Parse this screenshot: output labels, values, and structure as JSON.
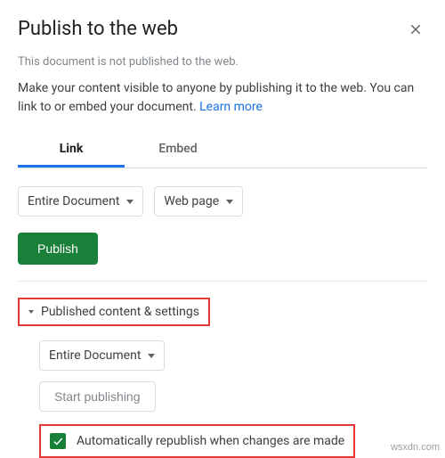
{
  "header": {
    "title": "Publish to the web",
    "subtitle": "This document is not published to the web.",
    "description_prefix": "Make your content visible to anyone by publishing it to the web. You can link to or embed your document. ",
    "learn_more": "Learn more"
  },
  "tabs": {
    "link": "Link",
    "embed": "Embed"
  },
  "selects": {
    "scope": "Entire Document",
    "format": "Web page"
  },
  "actions": {
    "publish": "Publish",
    "start_publishing": "Start publishing"
  },
  "section": {
    "heading": "Published content & settings",
    "scope2": "Entire Document",
    "auto_republish": "Automatically republish when changes are made"
  },
  "watermark": "wsxdn.com"
}
